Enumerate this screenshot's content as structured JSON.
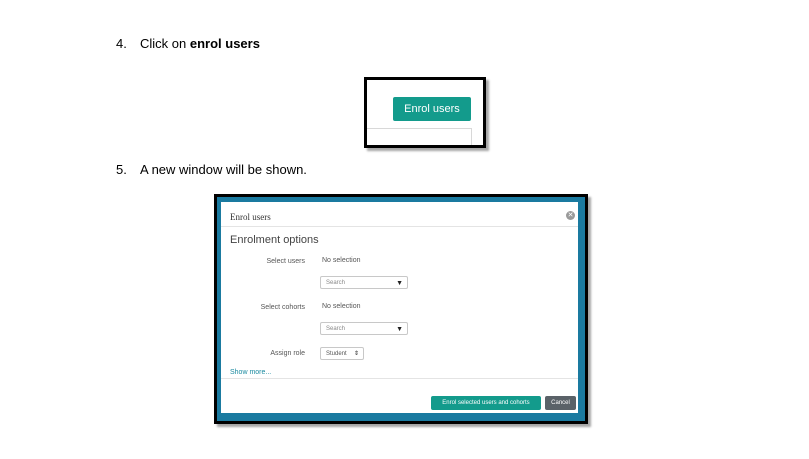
{
  "steps": [
    {
      "number": "4.",
      "text": "Click on ",
      "bold": "enrol users"
    },
    {
      "number": "5.",
      "text": "A new window will be shown."
    }
  ],
  "shot1": {
    "button_label": "Enrol users"
  },
  "modal": {
    "title": "Enrol users",
    "section_heading": "Enrolment options",
    "fields": [
      {
        "label": "Select users",
        "value": "No selection",
        "search_placeholder": "Search"
      },
      {
        "label": "Select cohorts",
        "value": "No selection",
        "search_placeholder": "Search"
      },
      {
        "label": "Assign role",
        "selected": "Student"
      }
    ],
    "show_more": "Show more...",
    "primary_button": "Enrol selected users and cohorts",
    "cancel_button": "Cancel"
  },
  "colors": {
    "accent": "#139b8c",
    "modal_frame": "#1a7aa0",
    "cancel": "#5a6268"
  }
}
